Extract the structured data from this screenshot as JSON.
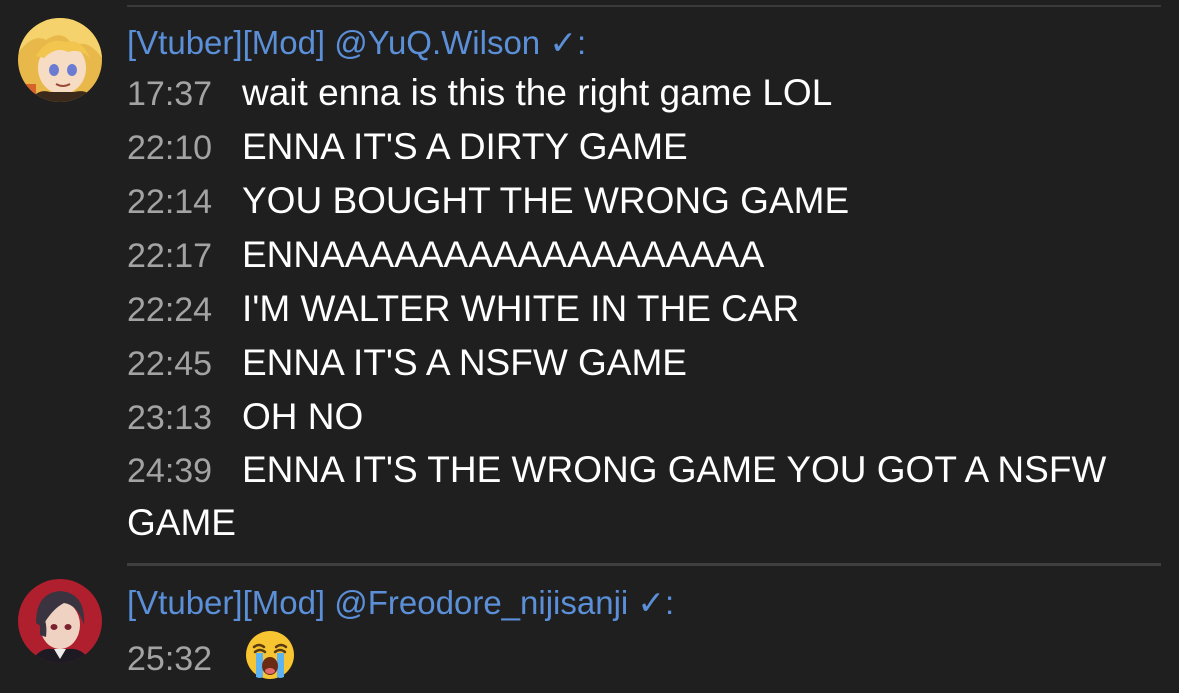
{
  "messages": [
    {
      "author": "[Vtuber][Mod] @YuQ.Wilson ✓:",
      "avatar_icon": "blonde-character-avatar",
      "lines": [
        {
          "time": "17:37",
          "text": "wait enna is this the right game LOL"
        },
        {
          "time": "22:10",
          "text": "ENNA IT'S A DIRTY GAME"
        },
        {
          "time": "22:14",
          "text": "YOU BOUGHT THE WRONG GAME"
        },
        {
          "time": "22:17",
          "text": "ENNAAAAAAAAAAAAAAAAAA"
        },
        {
          "time": "22:24",
          "text": "I'M WALTER WHITE IN THE CAR"
        },
        {
          "time": "22:45",
          "text": "ENNA IT'S A NSFW GAME"
        },
        {
          "time": "23:13",
          "text": "OH NO"
        },
        {
          "time": "24:39",
          "text": "ENNA IT'S THE WRONG GAME YOU GOT A NSFW GAME"
        }
      ]
    },
    {
      "author": "[Vtuber][Mod] @Freodore_nijisanji ✓:",
      "avatar_icon": "dark-haired-character-avatar",
      "lines": [
        {
          "time": "25:32",
          "emoji": "loudly-crying-face-emoji"
        }
      ]
    }
  ],
  "colors": {
    "background": "#1f1f1f",
    "author": "#5b8fd8",
    "timestamp": "#a3a3a3",
    "message": "#ffffff"
  }
}
